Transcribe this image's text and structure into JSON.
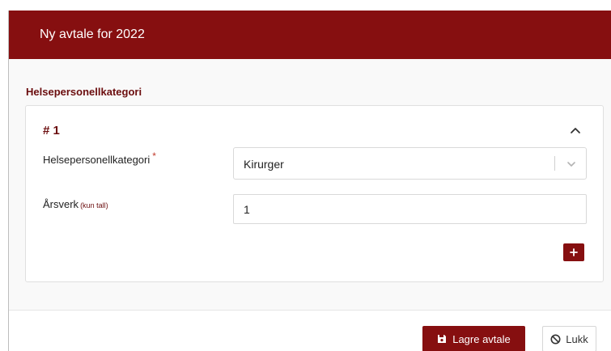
{
  "modal": {
    "title": "Ny avtale for 2022"
  },
  "section": {
    "heading": "Helsepersonellkategori"
  },
  "card": {
    "number": "# 1",
    "category": {
      "label": "Helsepersonellkategori",
      "required_marker": "*",
      "selected_value": "Kirurger"
    },
    "arsverk": {
      "label": "Årsverk",
      "hint": "(kun tall)",
      "value": "1"
    },
    "add_label": "+"
  },
  "footer": {
    "save_label": "Lagre avtale",
    "close_label": "Lukk"
  },
  "icons": {
    "collapse": "chevron-up-icon",
    "dropdown": "chevron-down-icon",
    "add": "plus-icon",
    "save": "floppy-disk-icon",
    "close": "ban-icon"
  },
  "colors": {
    "brand": "#860f10",
    "heading": "#6b0d0e",
    "required": "#c0392b"
  }
}
